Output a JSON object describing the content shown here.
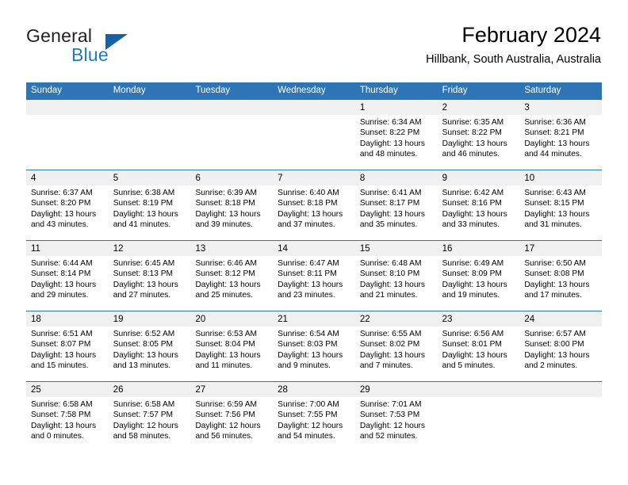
{
  "brand": {
    "name_part1": "General",
    "name_part2": "Blue",
    "triangle_color": "#1464a5",
    "blue_color": "#1f7ac4"
  },
  "header": {
    "title": "February 2024",
    "subtitle": "Hillbank, South Australia, Australia"
  },
  "theme": {
    "header_blue": "#2e75b6",
    "day_band_gray": "#f0f0f0"
  },
  "weekdays": [
    "Sunday",
    "Monday",
    "Tuesday",
    "Wednesday",
    "Thursday",
    "Friday",
    "Saturday"
  ],
  "weeks": [
    [
      {
        "day": "",
        "lines": [
          "",
          "",
          "",
          ""
        ]
      },
      {
        "day": "",
        "lines": [
          "",
          "",
          "",
          ""
        ]
      },
      {
        "day": "",
        "lines": [
          "",
          "",
          "",
          ""
        ]
      },
      {
        "day": "",
        "lines": [
          "",
          "",
          "",
          ""
        ]
      },
      {
        "day": "1",
        "lines": [
          "Sunrise: 6:34 AM",
          "Sunset: 8:22 PM",
          "Daylight: 13 hours",
          "and 48 minutes."
        ]
      },
      {
        "day": "2",
        "lines": [
          "Sunrise: 6:35 AM",
          "Sunset: 8:22 PM",
          "Daylight: 13 hours",
          "and 46 minutes."
        ]
      },
      {
        "day": "3",
        "lines": [
          "Sunrise: 6:36 AM",
          "Sunset: 8:21 PM",
          "Daylight: 13 hours",
          "and 44 minutes."
        ]
      }
    ],
    [
      {
        "day": "4",
        "lines": [
          "Sunrise: 6:37 AM",
          "Sunset: 8:20 PM",
          "Daylight: 13 hours",
          "and 43 minutes."
        ]
      },
      {
        "day": "5",
        "lines": [
          "Sunrise: 6:38 AM",
          "Sunset: 8:19 PM",
          "Daylight: 13 hours",
          "and 41 minutes."
        ]
      },
      {
        "day": "6",
        "lines": [
          "Sunrise: 6:39 AM",
          "Sunset: 8:18 PM",
          "Daylight: 13 hours",
          "and 39 minutes."
        ]
      },
      {
        "day": "7",
        "lines": [
          "Sunrise: 6:40 AM",
          "Sunset: 8:18 PM",
          "Daylight: 13 hours",
          "and 37 minutes."
        ]
      },
      {
        "day": "8",
        "lines": [
          "Sunrise: 6:41 AM",
          "Sunset: 8:17 PM",
          "Daylight: 13 hours",
          "and 35 minutes."
        ]
      },
      {
        "day": "9",
        "lines": [
          "Sunrise: 6:42 AM",
          "Sunset: 8:16 PM",
          "Daylight: 13 hours",
          "and 33 minutes."
        ]
      },
      {
        "day": "10",
        "lines": [
          "Sunrise: 6:43 AM",
          "Sunset: 8:15 PM",
          "Daylight: 13 hours",
          "and 31 minutes."
        ]
      }
    ],
    [
      {
        "day": "11",
        "lines": [
          "Sunrise: 6:44 AM",
          "Sunset: 8:14 PM",
          "Daylight: 13 hours",
          "and 29 minutes."
        ]
      },
      {
        "day": "12",
        "lines": [
          "Sunrise: 6:45 AM",
          "Sunset: 8:13 PM",
          "Daylight: 13 hours",
          "and 27 minutes."
        ]
      },
      {
        "day": "13",
        "lines": [
          "Sunrise: 6:46 AM",
          "Sunset: 8:12 PM",
          "Daylight: 13 hours",
          "and 25 minutes."
        ]
      },
      {
        "day": "14",
        "lines": [
          "Sunrise: 6:47 AM",
          "Sunset: 8:11 PM",
          "Daylight: 13 hours",
          "and 23 minutes."
        ]
      },
      {
        "day": "15",
        "lines": [
          "Sunrise: 6:48 AM",
          "Sunset: 8:10 PM",
          "Daylight: 13 hours",
          "and 21 minutes."
        ]
      },
      {
        "day": "16",
        "lines": [
          "Sunrise: 6:49 AM",
          "Sunset: 8:09 PM",
          "Daylight: 13 hours",
          "and 19 minutes."
        ]
      },
      {
        "day": "17",
        "lines": [
          "Sunrise: 6:50 AM",
          "Sunset: 8:08 PM",
          "Daylight: 13 hours",
          "and 17 minutes."
        ]
      }
    ],
    [
      {
        "day": "18",
        "lines": [
          "Sunrise: 6:51 AM",
          "Sunset: 8:07 PM",
          "Daylight: 13 hours",
          "and 15 minutes."
        ]
      },
      {
        "day": "19",
        "lines": [
          "Sunrise: 6:52 AM",
          "Sunset: 8:05 PM",
          "Daylight: 13 hours",
          "and 13 minutes."
        ]
      },
      {
        "day": "20",
        "lines": [
          "Sunrise: 6:53 AM",
          "Sunset: 8:04 PM",
          "Daylight: 13 hours",
          "and 11 minutes."
        ]
      },
      {
        "day": "21",
        "lines": [
          "Sunrise: 6:54 AM",
          "Sunset: 8:03 PM",
          "Daylight: 13 hours",
          "and 9 minutes."
        ]
      },
      {
        "day": "22",
        "lines": [
          "Sunrise: 6:55 AM",
          "Sunset: 8:02 PM",
          "Daylight: 13 hours",
          "and 7 minutes."
        ]
      },
      {
        "day": "23",
        "lines": [
          "Sunrise: 6:56 AM",
          "Sunset: 8:01 PM",
          "Daylight: 13 hours",
          "and 5 minutes."
        ]
      },
      {
        "day": "24",
        "lines": [
          "Sunrise: 6:57 AM",
          "Sunset: 8:00 PM",
          "Daylight: 13 hours",
          "and 2 minutes."
        ]
      }
    ],
    [
      {
        "day": "25",
        "lines": [
          "Sunrise: 6:58 AM",
          "Sunset: 7:58 PM",
          "Daylight: 13 hours",
          "and 0 minutes."
        ]
      },
      {
        "day": "26",
        "lines": [
          "Sunrise: 6:58 AM",
          "Sunset: 7:57 PM",
          "Daylight: 12 hours",
          "and 58 minutes."
        ]
      },
      {
        "day": "27",
        "lines": [
          "Sunrise: 6:59 AM",
          "Sunset: 7:56 PM",
          "Daylight: 12 hours",
          "and 56 minutes."
        ]
      },
      {
        "day": "28",
        "lines": [
          "Sunrise: 7:00 AM",
          "Sunset: 7:55 PM",
          "Daylight: 12 hours",
          "and 54 minutes."
        ]
      },
      {
        "day": "29",
        "lines": [
          "Sunrise: 7:01 AM",
          "Sunset: 7:53 PM",
          "Daylight: 12 hours",
          "and 52 minutes."
        ]
      },
      {
        "day": "",
        "lines": [
          "",
          "",
          "",
          ""
        ]
      },
      {
        "day": "",
        "lines": [
          "",
          "",
          "",
          ""
        ]
      }
    ]
  ]
}
